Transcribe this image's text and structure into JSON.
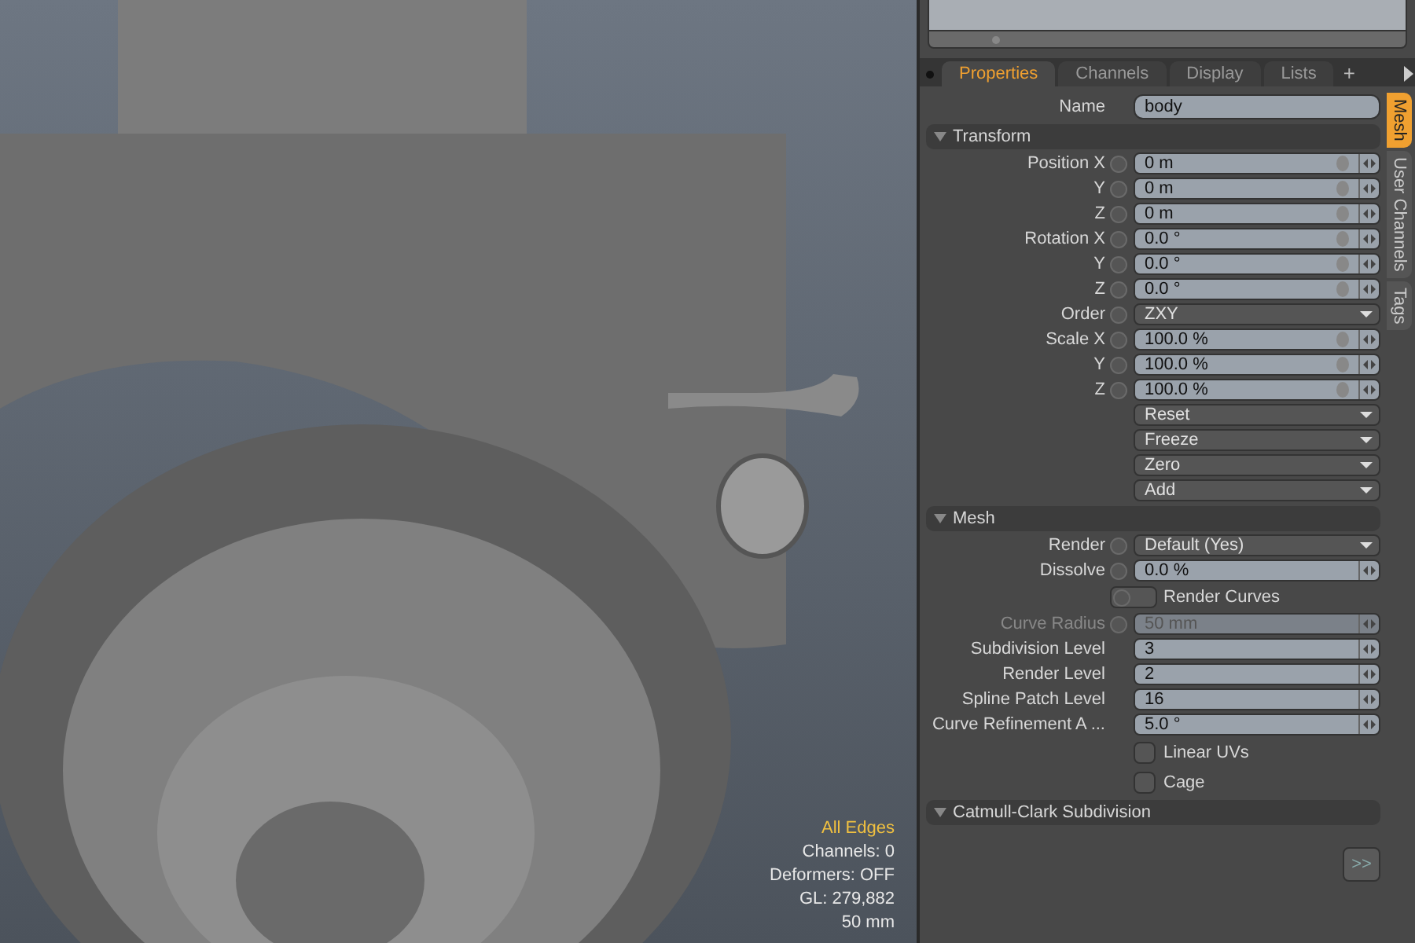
{
  "viewport": {
    "info": [
      {
        "text": "All Edges",
        "kind": "mode"
      },
      {
        "text": "Channels: 0",
        "kind": "stat"
      },
      {
        "text": "Deformers: OFF",
        "kind": "stat"
      },
      {
        "text": "GL: 279,882",
        "kind": "stat"
      },
      {
        "text": "50 mm",
        "kind": "stat"
      }
    ]
  },
  "tabs": [
    {
      "label": "Properties",
      "selected": true
    },
    {
      "label": "Channels",
      "selected": false
    },
    {
      "label": "Display",
      "selected": false
    },
    {
      "label": "Lists",
      "selected": false
    }
  ],
  "add_tab": "+",
  "side_tabs": [
    {
      "label": "Mesh",
      "selected": true
    },
    {
      "label": "User Channels",
      "selected": false
    },
    {
      "label": "Tags",
      "selected": false
    }
  ],
  "name_field": {
    "label": "Name",
    "value": "body"
  },
  "sections": [
    {
      "title": "Transform",
      "expanded": true,
      "rows": [
        {
          "kind": "channel",
          "label": "Position X",
          "value": "0 m"
        },
        {
          "kind": "channel",
          "label": "Y",
          "value": "0 m"
        },
        {
          "kind": "channel",
          "label": "Z",
          "value": "0 m"
        },
        {
          "kind": "channel",
          "label": "Rotation X",
          "value": "0.0 °"
        },
        {
          "kind": "channel",
          "label": "Y",
          "value": "0.0 °"
        },
        {
          "kind": "channel",
          "label": "Z",
          "value": "0.0 °"
        },
        {
          "kind": "dropdown",
          "label": "Order",
          "value": "ZXY"
        },
        {
          "kind": "channel",
          "label": "Scale X",
          "value": "100.0 %"
        },
        {
          "kind": "channel",
          "label": "Y",
          "value": "100.0 %"
        },
        {
          "kind": "channel",
          "label": "Z",
          "value": "100.0 %"
        },
        {
          "kind": "menu",
          "value": "Reset"
        },
        {
          "kind": "menu",
          "value": "Freeze"
        },
        {
          "kind": "menu",
          "value": "Zero"
        },
        {
          "kind": "menu",
          "value": "Add"
        }
      ]
    },
    {
      "title": "Mesh",
      "expanded": true,
      "rows": [
        {
          "kind": "dropdown",
          "label": "Render",
          "value": "Default (Yes)"
        },
        {
          "kind": "slider",
          "label": "Dissolve",
          "value": "0.0 %"
        },
        {
          "kind": "toggle",
          "value": "Render Curves",
          "checked": false
        },
        {
          "kind": "slider",
          "label": "Curve Radius",
          "value": "50 mm",
          "disabled": true
        },
        {
          "kind": "number",
          "label": "Subdivision Level",
          "value": "3"
        },
        {
          "kind": "number",
          "label": "Render Level",
          "value": "2"
        },
        {
          "kind": "number",
          "label": "Spline Patch Level",
          "value": "16"
        },
        {
          "kind": "number",
          "label": "Curve Refinement A ...",
          "value": "5.0 °"
        },
        {
          "kind": "checkbox",
          "value": "Linear UVs",
          "checked": false
        },
        {
          "kind": "checkbox",
          "value": "Cage",
          "checked": false
        }
      ]
    },
    {
      "title": "Catmull-Clark Subdivision",
      "expanded": true
    }
  ],
  "more_button": ">>"
}
